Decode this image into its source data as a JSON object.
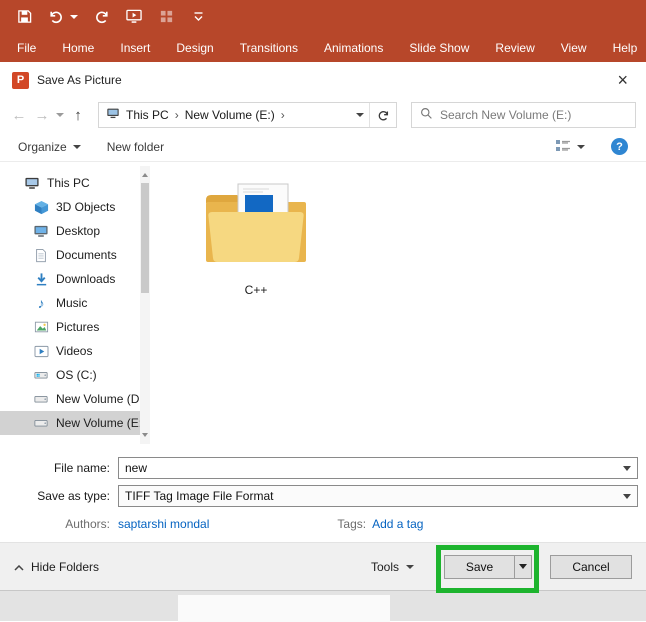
{
  "colors": {
    "ribbon_red": "#b7472a",
    "annotation_green": "#1db42e",
    "link_blue": "#0563c1",
    "help_blue": "#2f86d2",
    "powerpoint_icon": "#d24726"
  },
  "ribbon": {
    "tabs": [
      "File",
      "Home",
      "Insert",
      "Design",
      "Transitions",
      "Animations",
      "Slide Show",
      "Review",
      "View",
      "Help"
    ]
  },
  "dialog": {
    "title": "Save As Picture",
    "close_glyph": "×",
    "nav": {
      "back_glyph": "←",
      "forward_glyph": "→",
      "up_glyph": "↑",
      "breadcrumb_root": "This PC",
      "breadcrumb_current": "New Volume (E:)",
      "breadcrumb_sep": "›",
      "search_placeholder": "Search New Volume (E:)"
    },
    "toolbar": {
      "organize": "Organize",
      "new_folder": "New folder",
      "help_glyph": "?"
    },
    "sidebar": [
      "This PC",
      "3D Objects",
      "Desktop",
      "Documents",
      "Downloads",
      "Music",
      "Pictures",
      "Videos",
      "OS (C:)",
      "New Volume (D:",
      "New Volume (E:)"
    ],
    "selected_sidebar_item": "New Volume (E:)",
    "files": [
      {
        "name": "C++"
      }
    ],
    "form": {
      "file_name_label": "File name:",
      "file_name_value": "new",
      "save_type_label": "Save as type:",
      "save_type_value": "TIFF Tag Image File Format",
      "authors_label": "Authors:",
      "authors_value": "saptarshi mondal",
      "tags_label": "Tags:",
      "tags_value": "Add a tag"
    },
    "footer": {
      "hide_folders": "Hide Folders",
      "tools": "Tools",
      "save": "Save",
      "cancel": "Cancel"
    }
  },
  "powerpoint_icon_letter": "P"
}
